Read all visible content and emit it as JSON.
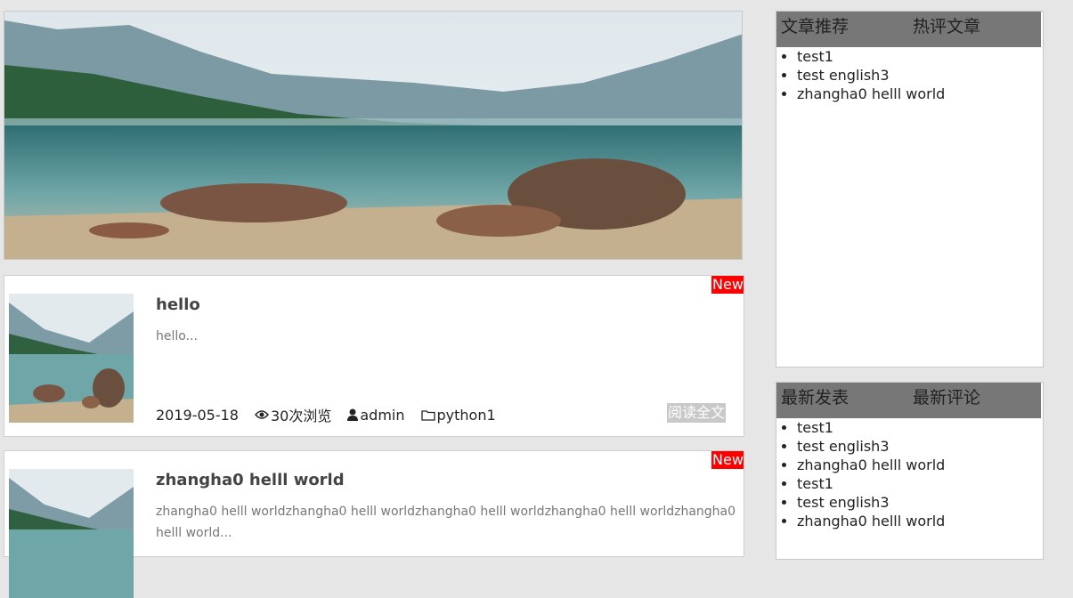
{
  "posts": [
    {
      "badge": "New",
      "title": "hello",
      "excerpt": "hello...",
      "date": "2019-05-18",
      "views": "30次浏览",
      "author": "admin",
      "category": "python1",
      "read_more": "阅读全文"
    },
    {
      "badge": "New",
      "title": "zhangha0 helll world",
      "excerpt": "zhangha0 helll worldzhangha0 helll worldzhangha0 helll worldzhangha0 helll worldzhangha0 helll world..."
    }
  ],
  "sidebar": {
    "box1": {
      "tabs": [
        "文章推荐",
        "热评文章"
      ],
      "items": [
        "test1",
        "test english3",
        "zhangha0 helll world"
      ]
    },
    "box2": {
      "tabs": [
        "最新发表",
        "最新评论"
      ],
      "items": [
        "test1",
        "test english3",
        "zhangha0 helll world",
        "test1",
        "test english3",
        "zhangha0 helll world"
      ]
    }
  },
  "colors": {
    "badge_bg": "#ff0000",
    "side_header_bg": "#777777",
    "read_more_bg": "#c8c8c8"
  }
}
